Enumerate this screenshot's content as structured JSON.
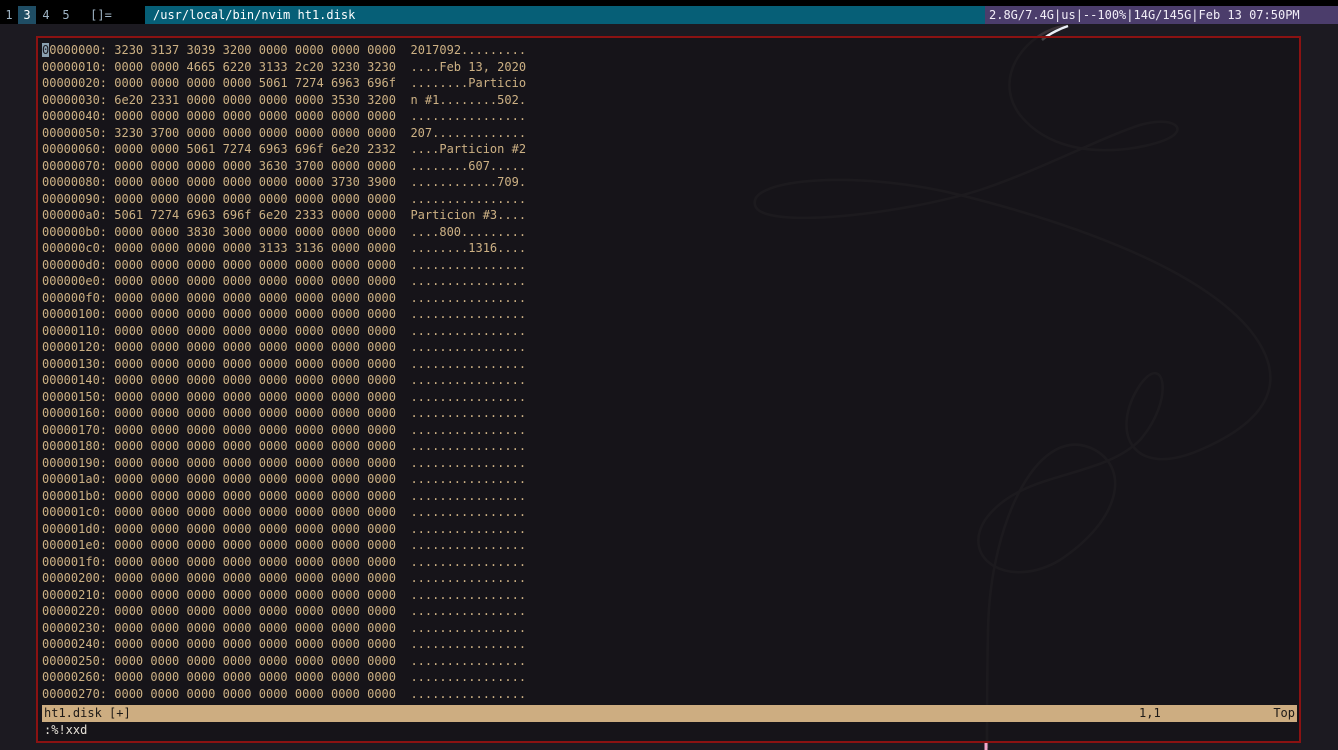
{
  "topbar": {
    "workspaces": [
      "1",
      "3",
      "4",
      "5",
      "[]="
    ],
    "active_workspace": "3",
    "window_title": "/usr/local/bin/nvim ht1.disk",
    "sysinfo": "2.8G/7.4G|us|--100%|14G/145G|Feb 13 07:50PM"
  },
  "editor": {
    "lines": [
      "00000000: 3230 3137 3039 3200 0000 0000 0000 0000  2017092.........",
      "00000010: 0000 0000 4665 6220 3133 2c20 3230 3230  ....Feb 13, 2020",
      "00000020: 0000 0000 0000 0000 5061 7274 6963 696f  ........Particio",
      "00000030: 6e20 2331 0000 0000 0000 0000 3530 3200  n #1........502.",
      "00000040: 0000 0000 0000 0000 0000 0000 0000 0000  ................",
      "00000050: 3230 3700 0000 0000 0000 0000 0000 0000  207.............",
      "00000060: 0000 0000 5061 7274 6963 696f 6e20 2332  ....Particion #2",
      "00000070: 0000 0000 0000 0000 3630 3700 0000 0000  ........607.....",
      "00000080: 0000 0000 0000 0000 0000 0000 3730 3900  ............709.",
      "00000090: 0000 0000 0000 0000 0000 0000 0000 0000  ................",
      "000000a0: 5061 7274 6963 696f 6e20 2333 0000 0000  Particion #3....",
      "000000b0: 0000 0000 3830 3000 0000 0000 0000 0000  ....800.........",
      "000000c0: 0000 0000 0000 0000 3133 3136 0000 0000  ........1316....",
      "000000d0: 0000 0000 0000 0000 0000 0000 0000 0000  ................",
      "000000e0: 0000 0000 0000 0000 0000 0000 0000 0000  ................",
      "000000f0: 0000 0000 0000 0000 0000 0000 0000 0000  ................",
      "00000100: 0000 0000 0000 0000 0000 0000 0000 0000  ................",
      "00000110: 0000 0000 0000 0000 0000 0000 0000 0000  ................",
      "00000120: 0000 0000 0000 0000 0000 0000 0000 0000  ................",
      "00000130: 0000 0000 0000 0000 0000 0000 0000 0000  ................",
      "00000140: 0000 0000 0000 0000 0000 0000 0000 0000  ................",
      "00000150: 0000 0000 0000 0000 0000 0000 0000 0000  ................",
      "00000160: 0000 0000 0000 0000 0000 0000 0000 0000  ................",
      "00000170: 0000 0000 0000 0000 0000 0000 0000 0000  ................",
      "00000180: 0000 0000 0000 0000 0000 0000 0000 0000  ................",
      "00000190: 0000 0000 0000 0000 0000 0000 0000 0000  ................",
      "000001a0: 0000 0000 0000 0000 0000 0000 0000 0000  ................",
      "000001b0: 0000 0000 0000 0000 0000 0000 0000 0000  ................",
      "000001c0: 0000 0000 0000 0000 0000 0000 0000 0000  ................",
      "000001d0: 0000 0000 0000 0000 0000 0000 0000 0000  ................",
      "000001e0: 0000 0000 0000 0000 0000 0000 0000 0000  ................",
      "000001f0: 0000 0000 0000 0000 0000 0000 0000 0000  ................",
      "00000200: 0000 0000 0000 0000 0000 0000 0000 0000  ................",
      "00000210: 0000 0000 0000 0000 0000 0000 0000 0000  ................",
      "00000220: 0000 0000 0000 0000 0000 0000 0000 0000  ................",
      "00000230: 0000 0000 0000 0000 0000 0000 0000 0000  ................",
      "00000240: 0000 0000 0000 0000 0000 0000 0000 0000  ................",
      "00000250: 0000 0000 0000 0000 0000 0000 0000 0000  ................",
      "00000260: 0000 0000 0000 0000 0000 0000 0000 0000  ................",
      "00000270: 0000 0000 0000 0000 0000 0000 0000 0000  ................"
    ]
  },
  "statusline": {
    "filename": "ht1.disk [+]",
    "position": "1,1",
    "scroll": "Top"
  },
  "cmdline": {
    "text": ":%!xxd"
  },
  "colors": {
    "window_border": "#8b1212",
    "title_bar": "#065f77",
    "sysinfo_bar": "#4b3d6b",
    "text": "#cdb184",
    "statusline_bg": "#cdad81"
  }
}
